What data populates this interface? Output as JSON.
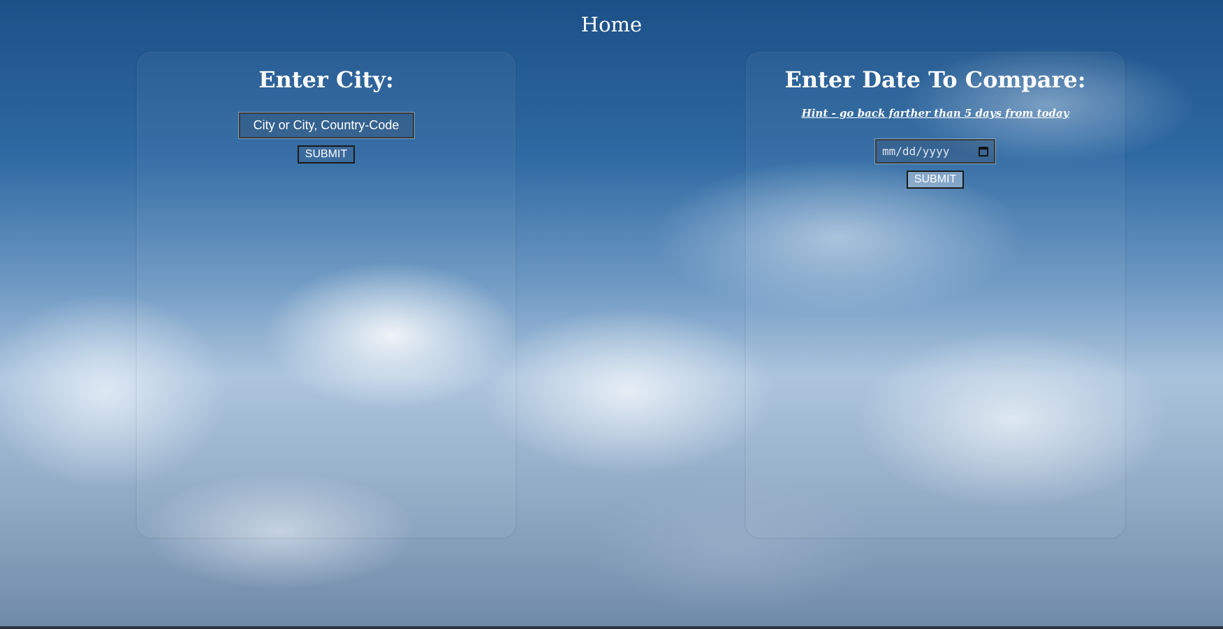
{
  "nav": {
    "home_label": "Home"
  },
  "city_panel": {
    "heading": "Enter City:",
    "input_placeholder": "City or City, Country-Code",
    "submit_label": "SUBMIT"
  },
  "date_panel": {
    "heading": "Enter Date To Compare:",
    "hint": "Hint - go back farther than 5 days from today",
    "date_placeholder": "mm/dd/yyyy",
    "submit_label": "SUBMIT"
  }
}
